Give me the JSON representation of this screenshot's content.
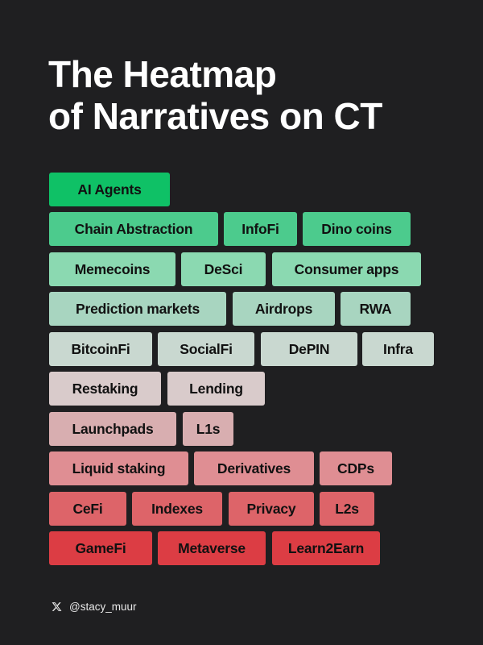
{
  "title": {
    "line1": "The Heatmap",
    "line2": "of Narratives on CT"
  },
  "palette": {
    "background": "#1f1f21",
    "hottest": "#0fc166",
    "coldest": "#dc3d44"
  },
  "rows": [
    {
      "color": "#0fc166",
      "items": [
        "AI Agents"
      ]
    },
    {
      "color": "#4ccb8d",
      "items": [
        "Chain Abstraction",
        "InfoFi",
        "Dino coins"
      ]
    },
    {
      "color": "#8bd9b1",
      "items": [
        "Memecoins",
        "DeSci",
        "Consumer apps"
      ]
    },
    {
      "color": "#a8d5c0",
      "items": [
        "Prediction markets",
        "Airdrops",
        "RWA"
      ]
    },
    {
      "color": "#c9d8d0",
      "items": [
        "BitcoinFi",
        "SocialFi",
        "DePIN",
        "Infra"
      ]
    },
    {
      "color": "#d9cbcb",
      "items": [
        "Restaking",
        "Lending"
      ]
    },
    {
      "color": "#d8aeb0",
      "items": [
        "Launchpads",
        "L1s"
      ]
    },
    {
      "color": "#df8e93",
      "items": [
        "Liquid staking",
        "Derivatives",
        "CDPs"
      ]
    },
    {
      "color": "#dd6469",
      "items": [
        "CeFi",
        "Indexes",
        "Privacy",
        "L2s"
      ]
    },
    {
      "color": "#dc3d44",
      "items": [
        "GameFi",
        "Metaverse",
        "Learn2Earn"
      ]
    }
  ],
  "footer": {
    "icon": "x-logo-icon",
    "handle": "@stacy_muur"
  }
}
